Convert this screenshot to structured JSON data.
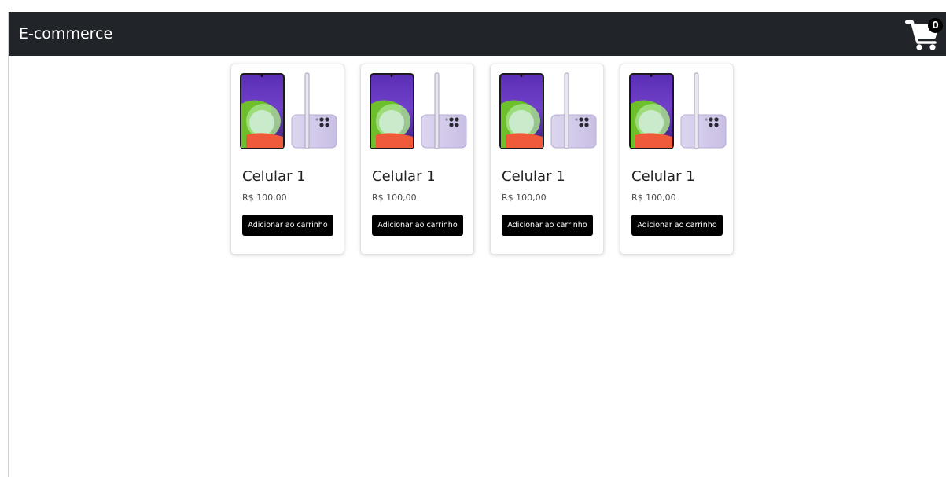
{
  "navbar": {
    "brand": "E-commerce",
    "cart_count": "0"
  },
  "products": [
    {
      "title": "Celular 1",
      "price": "R$ 100,00",
      "button_label": "Adicionar ao carrinho"
    },
    {
      "title": "Celular 1",
      "price": "R$ 100,00",
      "button_label": "Adicionar ao carrinho"
    },
    {
      "title": "Celular 1",
      "price": "R$ 100,00",
      "button_label": "Adicionar ao carrinho"
    },
    {
      "title": "Celular 1",
      "price": "R$ 100,00",
      "button_label": "Adicionar ao carrinho"
    }
  ],
  "icons": {
    "cart": "shopping-cart-icon",
    "product_image": "phone-image"
  },
  "colors": {
    "navbar_bg": "#212529",
    "button_bg": "#000000",
    "badge_bg": "#000000"
  }
}
